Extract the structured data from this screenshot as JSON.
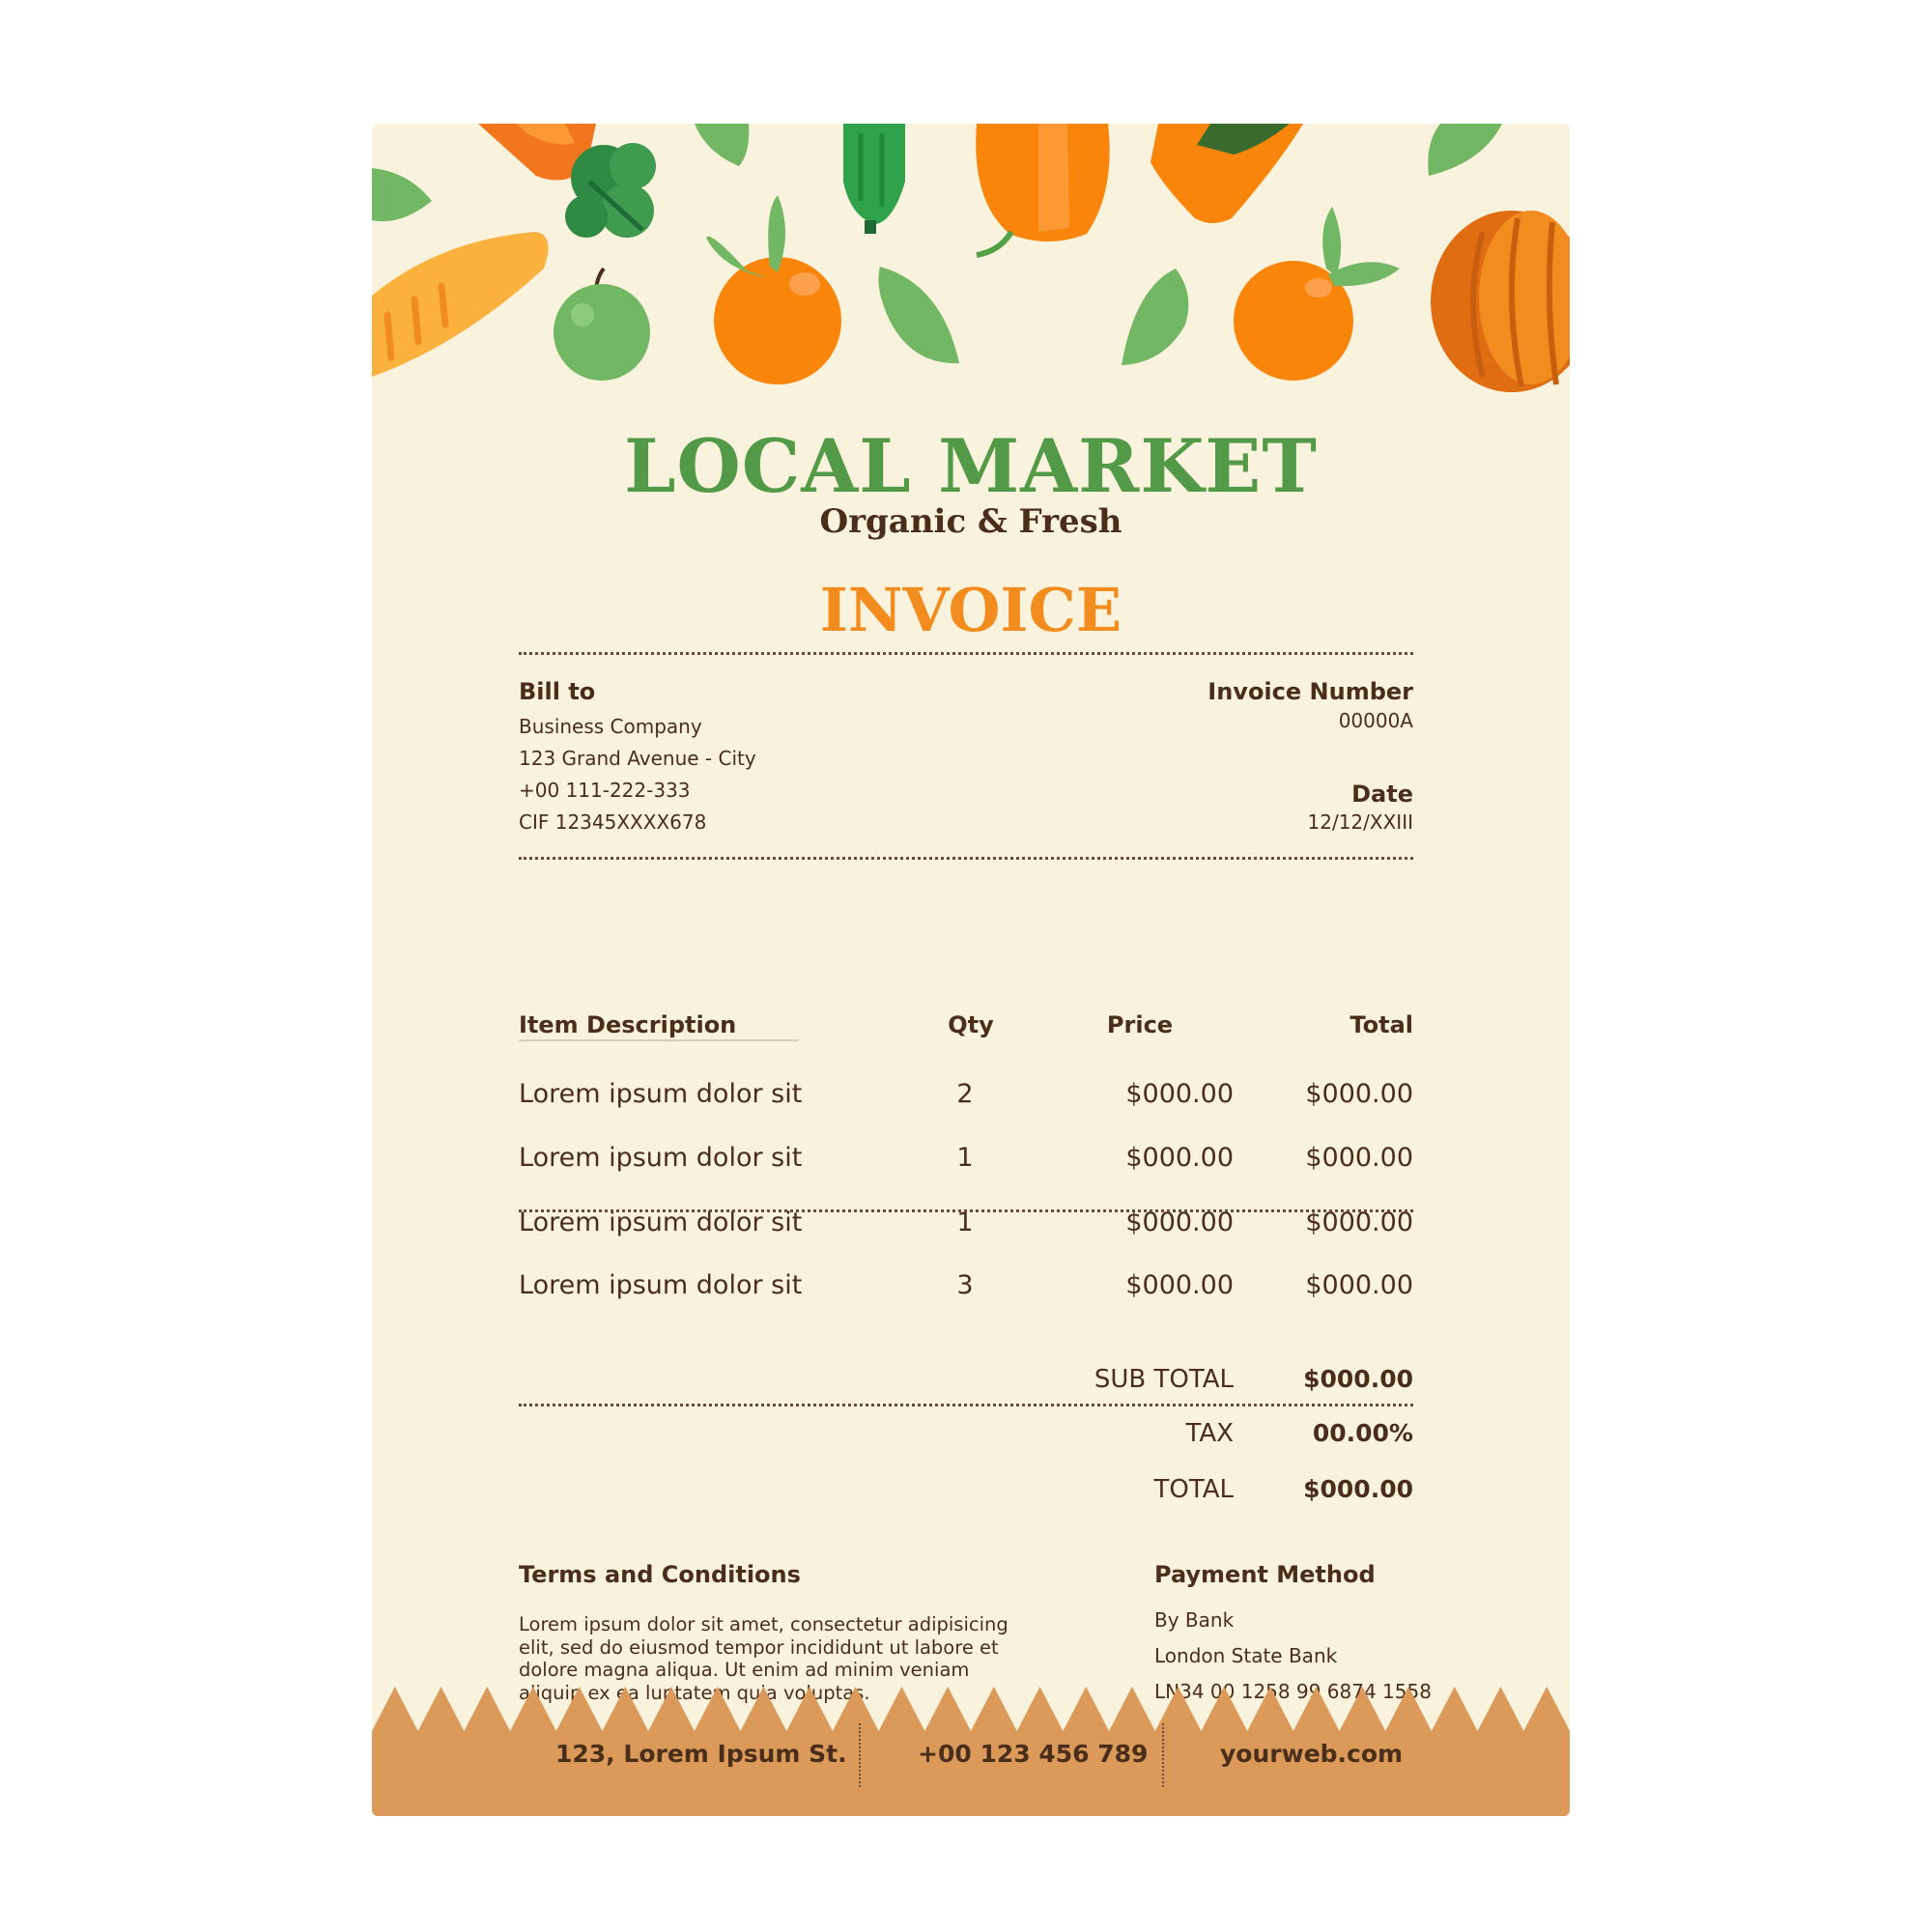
{
  "brand": {
    "name": "LOCAL MARKET",
    "tagline": "Organic & Fresh"
  },
  "document": {
    "title": "INVOICE"
  },
  "bill_to": {
    "label": "Bill to",
    "lines": [
      "Business Company",
      "123 Grand Avenue - City",
      "+00 111-222-333",
      "CIF 12345XXXX678"
    ]
  },
  "invoice_number": {
    "label": "Invoice Number",
    "value": "00000A"
  },
  "date": {
    "label": "Date",
    "value": "12/12/XXIII"
  },
  "table": {
    "headers": {
      "description": "Item Description",
      "qty": "Qty",
      "price": "Price",
      "total": "Total"
    },
    "rows": [
      {
        "description": "Lorem ipsum dolor sit",
        "qty": "2",
        "price": "$000.00",
        "total": "$000.00"
      },
      {
        "description": "Lorem ipsum dolor sit",
        "qty": "1",
        "price": "$000.00",
        "total": "$000.00"
      },
      {
        "description": "Lorem ipsum dolor sit",
        "qty": "1",
        "price": "$000.00",
        "total": "$000.00"
      },
      {
        "description": "Lorem ipsum dolor sit",
        "qty": "3",
        "price": "$000.00",
        "total": "$000.00"
      }
    ]
  },
  "totals": {
    "subtotal_label": "SUB TOTAL",
    "subtotal_value": "$000.00",
    "tax_label": "TAX",
    "tax_value": "00.00%",
    "total_label": "TOTAL",
    "total_value": "$000.00"
  },
  "terms": {
    "label": "Terms and Conditions",
    "lines": [
      "Lorem ipsum dolor sit amet, consectetur adipisicing",
      "elit, sed do eiusmod tempor incididunt ut labore  et",
      "dolore magna aliqua. Ut enim ad minim veniam",
      "aliquip ex ea luptatem quia voluptas."
    ]
  },
  "payment": {
    "label": "Payment Method",
    "lines": [
      "By Bank",
      "London State Bank",
      "LN34 00 1258 99 6874 1558"
    ]
  },
  "footer": {
    "address": "123, Lorem Ipsum St.",
    "phone": "+00 123 456 789",
    "website": "yourweb.com"
  },
  "colors": {
    "paper": "#f9f2dc",
    "brand_green": "#529a47",
    "accent_orange": "#f28c1e",
    "text_brown": "#4a2e1a",
    "footer_tan": "#db9a59"
  },
  "icons": [
    "carrot-icon",
    "lettuce-icon",
    "leaf-icon",
    "cucumber-icon",
    "pepper-icon",
    "juice-box-icon",
    "bread-icon",
    "apple-icon",
    "orange-icon",
    "pumpkin-icon"
  ]
}
